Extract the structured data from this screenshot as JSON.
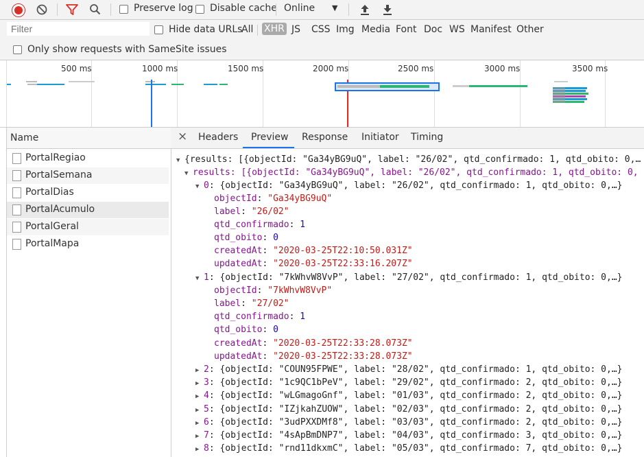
{
  "toolbar": {
    "preserve_log_label": "Preserve log",
    "disable_cache_label": "Disable cache",
    "throttle_value": "Online"
  },
  "filterbar": {
    "filter_placeholder": "Filter",
    "hide_data_urls_label": "Hide data URLs",
    "types": [
      "All",
      "XHR",
      "JS",
      "CSS",
      "Img",
      "Media",
      "Font",
      "Doc",
      "WS",
      "Manifest",
      "Other"
    ],
    "active_type": "XHR",
    "samesite_label": "Only show requests with SameSite issues"
  },
  "overview": {
    "ticks": [
      "500 ms",
      "1000 ms",
      "1500 ms",
      "2000 ms",
      "2500 ms",
      "3000 ms",
      "3500 ms"
    ]
  },
  "requests": {
    "header": "Name",
    "items": [
      "PortalRegiao",
      "PortalSemana",
      "PortalDias",
      "PortalAcumulo",
      "PortalGeral",
      "PortalMapa"
    ],
    "selected": "PortalAcumulo"
  },
  "detail": {
    "close": "×",
    "tabs": [
      "Headers",
      "Preview",
      "Response",
      "Initiator",
      "Timing"
    ],
    "active_tab": "Preview"
  },
  "preview": {
    "root_summary": "{results: [{objectId: \"Ga34yBG9uQ\", label: \"26/02\", qtd_confirmado: 1, qtd_obito: 0,…",
    "results_summary": "results: [{objectId: \"Ga34yBG9uQ\", label: \"26/02\", qtd_confirmado: 1, qtd_obito: 0,",
    "items": [
      {
        "index": "0",
        "summary": "{objectId: \"Ga34yBG9uQ\", label: \"26/02\", qtd_confirmado: 1, qtd_obito: 0,…}",
        "objectId": "\"Ga34yBG9uQ\"",
        "label": "\"26/02\"",
        "qtd_confirmado": "1",
        "qtd_obito": "0",
        "createdAt": "\"2020-03-25T22:10:50.031Z\"",
        "updatedAt": "\"2020-03-25T22:33:16.207Z\""
      },
      {
        "index": "1",
        "summary": "{objectId: \"7kWhvW8VvP\", label: \"27/02\", qtd_confirmado: 1, qtd_obito: 0,…}",
        "objectId": "\"7kWhvW8VvP\"",
        "label": "\"27/02\"",
        "qtd_confirmado": "1",
        "qtd_obito": "0",
        "createdAt": "\"2020-03-25T22:33:28.073Z\"",
        "updatedAt": "\"2020-03-25T22:33:28.073Z\""
      }
    ],
    "collapsed": [
      {
        "index": "2",
        "summary": "{objectId: \"COUN95FPWE\", label: \"28/02\", qtd_confirmado: 1, qtd_obito: 0,…}"
      },
      {
        "index": "3",
        "summary": "{objectId: \"1c9QC1bPeV\", label: \"29/02\", qtd_confirmado: 2, qtd_obito: 0,…}"
      },
      {
        "index": "4",
        "summary": "{objectId: \"wLGmagoGnf\", label: \"01/03\", qtd_confirmado: 2, qtd_obito: 0,…}"
      },
      {
        "index": "5",
        "summary": "{objectId: \"IZjkahZUOW\", label: \"02/03\", qtd_confirmado: 2, qtd_obito: 0,…}"
      },
      {
        "index": "6",
        "summary": "{objectId: \"3udPXXDMf8\", label: \"03/03\", qtd_confirmado: 2, qtd_obito: 0,…}"
      },
      {
        "index": "7",
        "summary": "{objectId: \"4sApBmDNP7\", label: \"04/03\", qtd_confirmado: 3, qtd_obito: 0,…}"
      },
      {
        "index": "8",
        "summary": "{objectId: \"rnd11dkxmC\", label: \"05/03\", qtd_confirmado: 7, qtd_obito: 0,…}"
      }
    ],
    "keys": {
      "objectId": "objectId",
      "label": "label",
      "qtd_confirmado": "qtd_confirmado",
      "qtd_obito": "qtd_obito",
      "createdAt": "createdAt",
      "updatedAt": "updatedAt"
    }
  },
  "colors": {
    "record": "#d93025",
    "filter_active": "#d93025",
    "key": "#881391",
    "string": "#c41a16",
    "number": "#1c00cf",
    "selection_blue": "#1a73e8"
  }
}
